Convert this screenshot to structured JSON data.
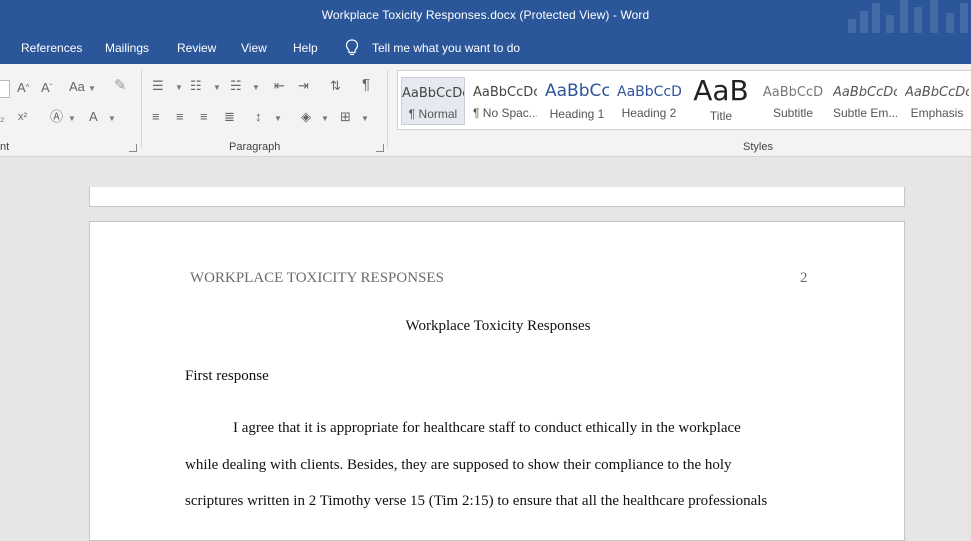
{
  "window": {
    "title": "Workplace Toxicity Responses.docx (Protected View)  -  Word"
  },
  "menu": {
    "tabs": [
      "References",
      "Mailings",
      "Review",
      "View",
      "Help"
    ],
    "tell_me": "Tell me what you want to do"
  },
  "ribbon": {
    "font_group_label": "nt",
    "paragraph_group_label": "Paragraph",
    "styles_group_label": "Styles",
    "styles": [
      {
        "sample": "AaBbCcDc",
        "name": "¶ Normal"
      },
      {
        "sample": "AaBbCcDc",
        "name": "¶ No Spac..."
      },
      {
        "sample": "AaBbCc",
        "name": "Heading 1"
      },
      {
        "sample": "AaBbCcD",
        "name": "Heading 2"
      },
      {
        "sample": "AaB",
        "name": "Title"
      },
      {
        "sample": "AaBbCcD",
        "name": "Subtitle"
      },
      {
        "sample": "AaBbCcDc",
        "name": "Subtle Em..."
      },
      {
        "sample": "AaBbCcDc",
        "name": "Emphasis"
      }
    ],
    "font_case_label": "Aa"
  },
  "document": {
    "running_head": "WORKPLACE TOXICITY RESPONSES",
    "page_number": "2",
    "title": "Workplace Toxicity Responses",
    "subheading": "First response",
    "lines": [
      "I agree that it is appropriate for healthcare staff to conduct ethically in the workplace",
      "while dealing with clients. Besides, they are supposed to show their compliance to the holy",
      "scriptures written in 2 Timothy verse 15 (Tim 2:15) to ensure that all the healthcare professionals"
    ]
  },
  "colors": {
    "title_bar": "#2b579a",
    "ribbon": "#f3f3f3",
    "canvas": "#e6e6e6"
  }
}
